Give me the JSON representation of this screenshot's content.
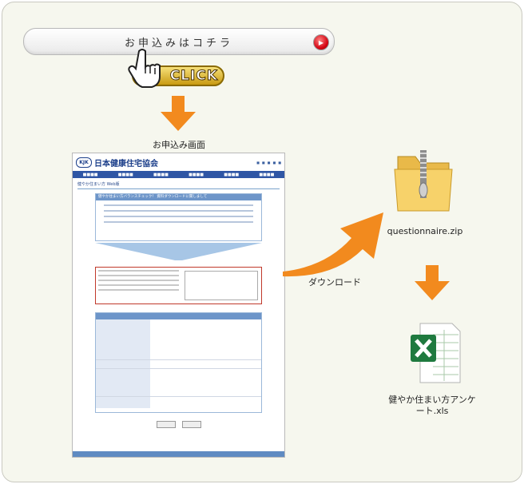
{
  "apply_button": {
    "label": "お申込みはコチラ"
  },
  "click_badge": {
    "label": "CLICK"
  },
  "screen_caption": "お申込み画面",
  "download_label": "ダウンロード",
  "zip_file": {
    "name": "questionnaire.zip"
  },
  "excel_file": {
    "name": "健やか住まい方アンケート.xls"
  },
  "form_screenshot": {
    "site_logo": "日本健康住宅協会",
    "page_section": "健やか住まい方 Web版",
    "download_box_title": "健やか住まい方バランスチェック！ 資料ダウンロードに関しまして",
    "form_title": "健やか住まい方バランスチェック！ 資料ダウンロード用フォーム"
  },
  "colors": {
    "arrow": "#f28a1e",
    "panel_bg": "#f6f7ee",
    "brand_blue": "#2f56a5"
  }
}
